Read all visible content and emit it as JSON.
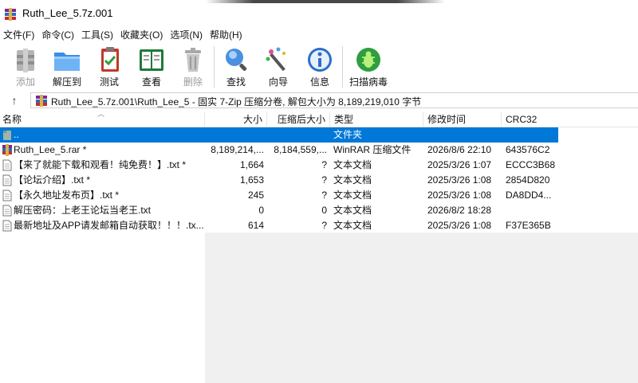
{
  "window": {
    "title": "Ruth_Lee_5.7z.001"
  },
  "menu": [
    "文件(F)",
    "命令(C)",
    "工具(S)",
    "收藏夹(O)",
    "选项(N)",
    "帮助(H)"
  ],
  "toolbar": {
    "add": "添加",
    "extract": "解压到",
    "test": "测试",
    "view": "查看",
    "delete": "删除",
    "find": "查找",
    "wizard": "向导",
    "info": "信息",
    "scan": "扫描病毒"
  },
  "address": {
    "path": "Ruth_Lee_5.7z.001\\Ruth_Lee_5 - 固实 7-Zip 压缩分卷, 解包大小为 8,189,219,010 字节"
  },
  "columns": {
    "name": "名称",
    "size": "大小",
    "packed": "压缩后大小",
    "type": "类型",
    "modified": "修改时间",
    "crc": "CRC32"
  },
  "rows": [
    {
      "name": "..",
      "size": "",
      "packed": "",
      "type": "文件夹",
      "modified": "",
      "crc": ""
    },
    {
      "name": "Ruth_Lee_5.rar *",
      "size": "8,189,214,...",
      "packed": "8,184,559,...",
      "type": "WinRAR 压缩文件",
      "modified": "2026/8/6 22:10",
      "crc": "643576C2"
    },
    {
      "name": "【来了就能下载和观看！纯免费！】.txt *",
      "size": "1,664",
      "packed": "?",
      "type": "文本文档",
      "modified": "2025/3/26 1:07",
      "crc": "ECCC3B68"
    },
    {
      "name": "【论坛介绍】.txt *",
      "size": "1,653",
      "packed": "?",
      "type": "文本文档",
      "modified": "2025/3/26 1:08",
      "crc": "2854D820"
    },
    {
      "name": "【永久地址发布页】.txt *",
      "size": "245",
      "packed": "?",
      "type": "文本文档",
      "modified": "2025/3/26 1:08",
      "crc": "DA8DD4..."
    },
    {
      "name": "解压密码：上老王论坛当老王.txt",
      "size": "0",
      "packed": "0",
      "type": "文本文档",
      "modified": "2026/8/2 18:28",
      "crc": ""
    },
    {
      "name": "最新地址及APP请发邮箱自动获取！！！.tx...",
      "size": "614",
      "packed": "?",
      "type": "文本文档",
      "modified": "2025/3/26 1:08",
      "crc": "F37E365B"
    }
  ]
}
